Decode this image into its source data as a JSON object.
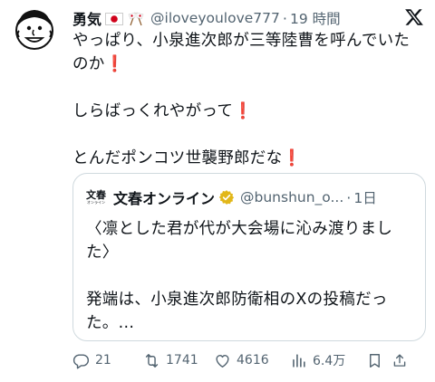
{
  "author": {
    "name": "勇気",
    "handle": "@iloveyoulove777",
    "separator": "·",
    "time": "19 時間",
    "avatar": "cartoon-face-avatar",
    "flags": [
      "japan-flag-icon",
      "crossed-flags-icon"
    ]
  },
  "post": {
    "lines": [
      "やっぱり、小泉進次郎が三等陸曹を呼んでいた",
      "のか",
      "しらばっくれやがって",
      "とんだポンコツ世襲野郎だな"
    ],
    "exclamation": "❗"
  },
  "quote": {
    "logo_text": "文春",
    "logo_sub": "オンライン",
    "name": "文春オンライン",
    "handle": "@bunshun_o...",
    "separator": "·",
    "time": "1日",
    "lines": [
      "〈凛とした君が代が大会場に沁み渡りまし",
      "た〉",
      "発端は、小泉進次郎防衛相のXの投稿だっ",
      "た。..."
    ]
  },
  "actions": {
    "replies": "21",
    "reposts": "1741",
    "likes": "4616",
    "views": "6.4万"
  },
  "colors": {
    "text": "#0f1419",
    "secondary": "#536471",
    "border": "#cfd9de",
    "exclamation": "#e0245e",
    "verified": "#e2b719"
  }
}
